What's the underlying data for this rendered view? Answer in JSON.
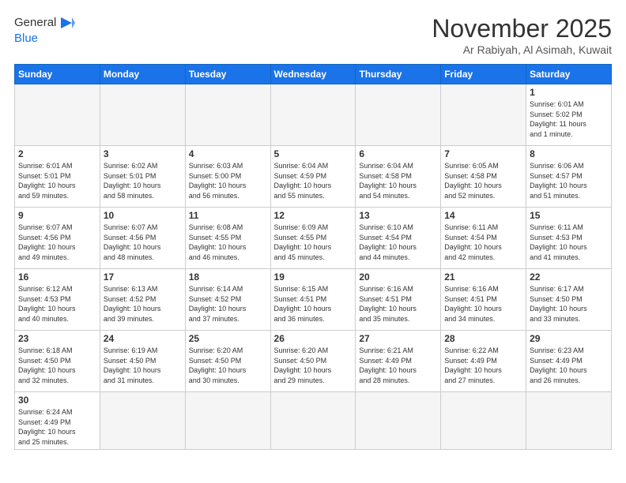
{
  "header": {
    "logo_general": "General",
    "logo_blue": "Blue",
    "title": "November 2025",
    "subtitle": "Ar Rabiyah, Al Asimah, Kuwait"
  },
  "weekdays": [
    "Sunday",
    "Monday",
    "Tuesday",
    "Wednesday",
    "Thursday",
    "Friday",
    "Saturday"
  ],
  "days": [
    {
      "num": "",
      "info": ""
    },
    {
      "num": "",
      "info": ""
    },
    {
      "num": "",
      "info": ""
    },
    {
      "num": "",
      "info": ""
    },
    {
      "num": "",
      "info": ""
    },
    {
      "num": "",
      "info": ""
    },
    {
      "num": "1",
      "info": "Sunrise: 6:01 AM\nSunset: 5:02 PM\nDaylight: 11 hours\nand 1 minute."
    },
    {
      "num": "2",
      "info": "Sunrise: 6:01 AM\nSunset: 5:01 PM\nDaylight: 10 hours\nand 59 minutes."
    },
    {
      "num": "3",
      "info": "Sunrise: 6:02 AM\nSunset: 5:01 PM\nDaylight: 10 hours\nand 58 minutes."
    },
    {
      "num": "4",
      "info": "Sunrise: 6:03 AM\nSunset: 5:00 PM\nDaylight: 10 hours\nand 56 minutes."
    },
    {
      "num": "5",
      "info": "Sunrise: 6:04 AM\nSunset: 4:59 PM\nDaylight: 10 hours\nand 55 minutes."
    },
    {
      "num": "6",
      "info": "Sunrise: 6:04 AM\nSunset: 4:58 PM\nDaylight: 10 hours\nand 54 minutes."
    },
    {
      "num": "7",
      "info": "Sunrise: 6:05 AM\nSunset: 4:58 PM\nDaylight: 10 hours\nand 52 minutes."
    },
    {
      "num": "8",
      "info": "Sunrise: 6:06 AM\nSunset: 4:57 PM\nDaylight: 10 hours\nand 51 minutes."
    },
    {
      "num": "9",
      "info": "Sunrise: 6:07 AM\nSunset: 4:56 PM\nDaylight: 10 hours\nand 49 minutes."
    },
    {
      "num": "10",
      "info": "Sunrise: 6:07 AM\nSunset: 4:56 PM\nDaylight: 10 hours\nand 48 minutes."
    },
    {
      "num": "11",
      "info": "Sunrise: 6:08 AM\nSunset: 4:55 PM\nDaylight: 10 hours\nand 46 minutes."
    },
    {
      "num": "12",
      "info": "Sunrise: 6:09 AM\nSunset: 4:55 PM\nDaylight: 10 hours\nand 45 minutes."
    },
    {
      "num": "13",
      "info": "Sunrise: 6:10 AM\nSunset: 4:54 PM\nDaylight: 10 hours\nand 44 minutes."
    },
    {
      "num": "14",
      "info": "Sunrise: 6:11 AM\nSunset: 4:54 PM\nDaylight: 10 hours\nand 42 minutes."
    },
    {
      "num": "15",
      "info": "Sunrise: 6:11 AM\nSunset: 4:53 PM\nDaylight: 10 hours\nand 41 minutes."
    },
    {
      "num": "16",
      "info": "Sunrise: 6:12 AM\nSunset: 4:53 PM\nDaylight: 10 hours\nand 40 minutes."
    },
    {
      "num": "17",
      "info": "Sunrise: 6:13 AM\nSunset: 4:52 PM\nDaylight: 10 hours\nand 39 minutes."
    },
    {
      "num": "18",
      "info": "Sunrise: 6:14 AM\nSunset: 4:52 PM\nDaylight: 10 hours\nand 37 minutes."
    },
    {
      "num": "19",
      "info": "Sunrise: 6:15 AM\nSunset: 4:51 PM\nDaylight: 10 hours\nand 36 minutes."
    },
    {
      "num": "20",
      "info": "Sunrise: 6:16 AM\nSunset: 4:51 PM\nDaylight: 10 hours\nand 35 minutes."
    },
    {
      "num": "21",
      "info": "Sunrise: 6:16 AM\nSunset: 4:51 PM\nDaylight: 10 hours\nand 34 minutes."
    },
    {
      "num": "22",
      "info": "Sunrise: 6:17 AM\nSunset: 4:50 PM\nDaylight: 10 hours\nand 33 minutes."
    },
    {
      "num": "23",
      "info": "Sunrise: 6:18 AM\nSunset: 4:50 PM\nDaylight: 10 hours\nand 32 minutes."
    },
    {
      "num": "24",
      "info": "Sunrise: 6:19 AM\nSunset: 4:50 PM\nDaylight: 10 hours\nand 31 minutes."
    },
    {
      "num": "25",
      "info": "Sunrise: 6:20 AM\nSunset: 4:50 PM\nDaylight: 10 hours\nand 30 minutes."
    },
    {
      "num": "26",
      "info": "Sunrise: 6:20 AM\nSunset: 4:50 PM\nDaylight: 10 hours\nand 29 minutes."
    },
    {
      "num": "27",
      "info": "Sunrise: 6:21 AM\nSunset: 4:49 PM\nDaylight: 10 hours\nand 28 minutes."
    },
    {
      "num": "28",
      "info": "Sunrise: 6:22 AM\nSunset: 4:49 PM\nDaylight: 10 hours\nand 27 minutes."
    },
    {
      "num": "29",
      "info": "Sunrise: 6:23 AM\nSunset: 4:49 PM\nDaylight: 10 hours\nand 26 minutes."
    },
    {
      "num": "30",
      "info": "Sunrise: 6:24 AM\nSunset: 4:49 PM\nDaylight: 10 hours\nand 25 minutes."
    },
    {
      "num": "",
      "info": ""
    },
    {
      "num": "",
      "info": ""
    },
    {
      "num": "",
      "info": ""
    },
    {
      "num": "",
      "info": ""
    },
    {
      "num": "",
      "info": ""
    },
    {
      "num": "",
      "info": ""
    }
  ]
}
